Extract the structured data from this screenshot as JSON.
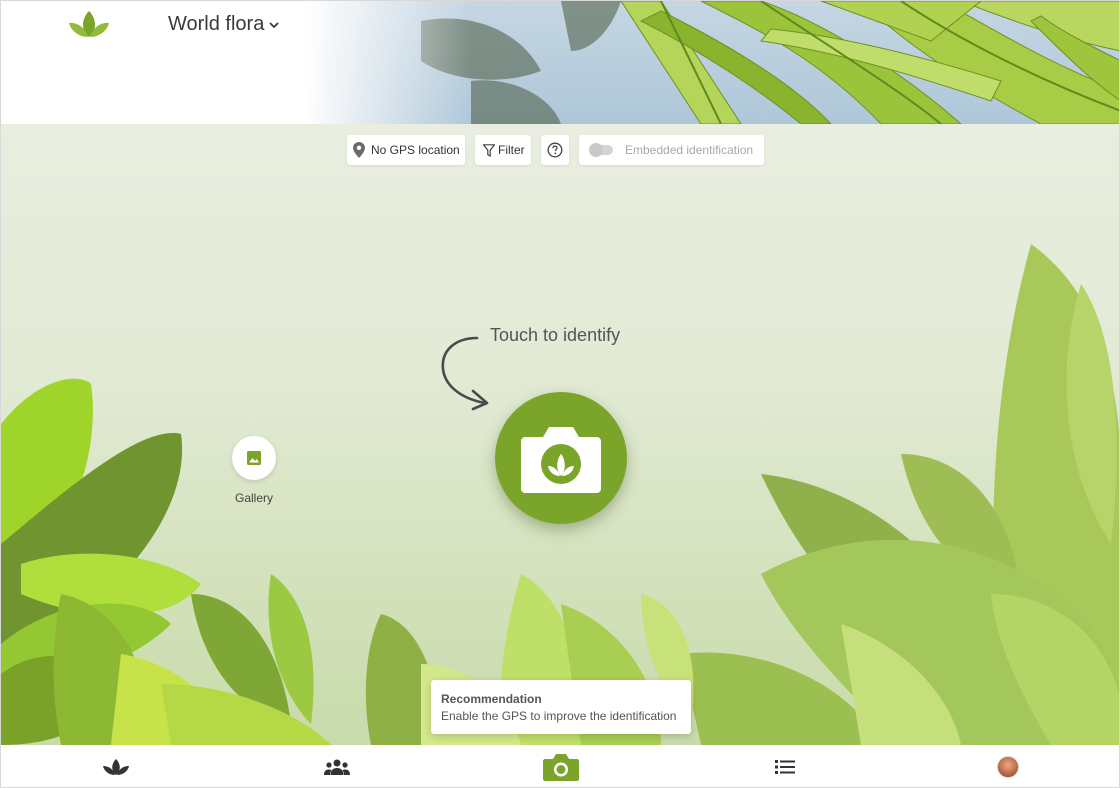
{
  "header": {
    "flora_name": "World flora",
    "flora_dropdown_icon": "chevron-down-icon",
    "logo_icon": "leaf-logo-icon"
  },
  "toolbar": {
    "gps_label": "No GPS location",
    "gps_icon": "location-pin-icon",
    "filter_label": "Filter",
    "filter_icon": "filter-icon",
    "help_icon": "help-circle-icon",
    "embedded_label": "Embedded identification",
    "embedded_enabled": false
  },
  "identify": {
    "hint": "Touch to identify",
    "camera_icon": "camera-leaf-icon"
  },
  "gallery": {
    "label": "Gallery",
    "icon": "image-icon"
  },
  "toast": {
    "title": "Recommendation",
    "message": "Enable the GPS to improve the identification"
  },
  "bottom_nav": [
    {
      "name": "identify",
      "icon": "leaf-icon"
    },
    {
      "name": "community",
      "icon": "people-icon"
    },
    {
      "name": "camera",
      "icon": "camera-icon",
      "active": true
    },
    {
      "name": "list",
      "icon": "list-icon"
    },
    {
      "name": "profile",
      "icon": "avatar"
    }
  ],
  "colors": {
    "accent": "#7ba52a",
    "nav_inactive": "#333333",
    "toast_bg": "#ffffff"
  }
}
